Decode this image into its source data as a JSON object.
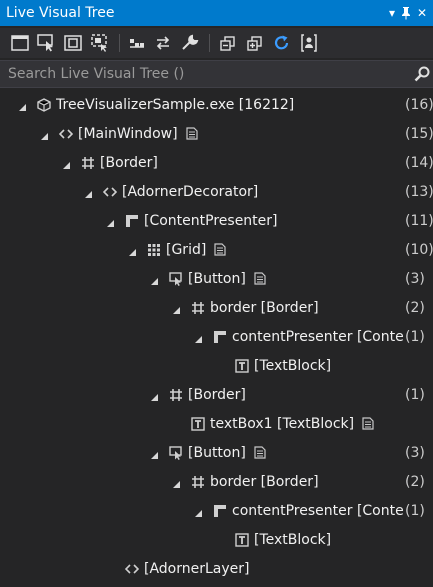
{
  "window": {
    "title": "Live Visual Tree",
    "dropdown_glyph": "▾",
    "pin_glyph": "⊥",
    "close_glyph": "✕"
  },
  "toolbar": {
    "icons": [
      "window-icon",
      "select-element-icon",
      "display-adorners-icon",
      "track-focus-icon",
      "show-just-my-xaml-icon",
      "preview-selection-icon",
      "properties-wrench-icon",
      "collapse-all-icon",
      "expand-all-icon",
      "refresh-icon",
      "hot-reload-icon"
    ]
  },
  "search": {
    "placeholder": "Search Live Visual Tree ()",
    "value": ""
  },
  "colors": {
    "title_bar": "#007acc",
    "background": "#252526",
    "text": "#f1f1f1",
    "count_text": "#cccccc"
  },
  "tree": {
    "nodes": [
      {
        "label": "TreeVisualizerSample.exe [16212]",
        "count": "(16)",
        "icon": "process-icon",
        "expanded": true,
        "has_props": false
      },
      {
        "label": "[MainWindow]",
        "count": "(15)",
        "icon": "xaml-tag-icon",
        "expanded": true,
        "has_props": true
      },
      {
        "label": "[Border]",
        "count": "(14)",
        "icon": "border-icon",
        "expanded": true,
        "has_props": false
      },
      {
        "label": "[AdornerDecorator]",
        "count": "(13)",
        "icon": "xaml-tag-icon",
        "expanded": true,
        "has_props": false
      },
      {
        "label": "[ContentPresenter]",
        "count": "(11)",
        "icon": "content-presenter-icon",
        "expanded": true,
        "has_props": false
      },
      {
        "label": "[Grid]",
        "count": "(10)",
        "icon": "grid-icon",
        "expanded": true,
        "has_props": true
      },
      {
        "label": "[Button]",
        "count": "(3)",
        "icon": "button-icon",
        "expanded": true,
        "has_props": true
      },
      {
        "label": "border [Border]",
        "count": "(2)",
        "icon": "border-icon",
        "expanded": true,
        "has_props": false
      },
      {
        "label": "contentPresenter [ContentPresenter]",
        "count": "(1)",
        "icon": "content-presenter-icon",
        "expanded": true,
        "has_props": false
      },
      {
        "label": "[TextBlock]",
        "count": "",
        "icon": "textblock-icon",
        "expanded": false,
        "has_props": false
      },
      {
        "label": "[Border]",
        "count": "(1)",
        "icon": "border-icon",
        "expanded": true,
        "has_props": false
      },
      {
        "label": "textBox1 [TextBlock]",
        "count": "",
        "icon": "textblock-icon",
        "expanded": false,
        "has_props": true
      },
      {
        "label": "[Button]",
        "count": "(3)",
        "icon": "button-icon",
        "expanded": true,
        "has_props": true
      },
      {
        "label": "border [Border]",
        "count": "(2)",
        "icon": "border-icon",
        "expanded": true,
        "has_props": false
      },
      {
        "label": "contentPresenter [ContentPresenter]",
        "count": "(1)",
        "icon": "content-presenter-icon",
        "expanded": true,
        "has_props": false
      },
      {
        "label": "[TextBlock]",
        "count": "",
        "icon": "textblock-icon",
        "expanded": false,
        "has_props": false
      },
      {
        "label": "[AdornerLayer]",
        "count": "",
        "icon": "xaml-tag-icon",
        "expanded": false,
        "has_props": false
      }
    ]
  }
}
